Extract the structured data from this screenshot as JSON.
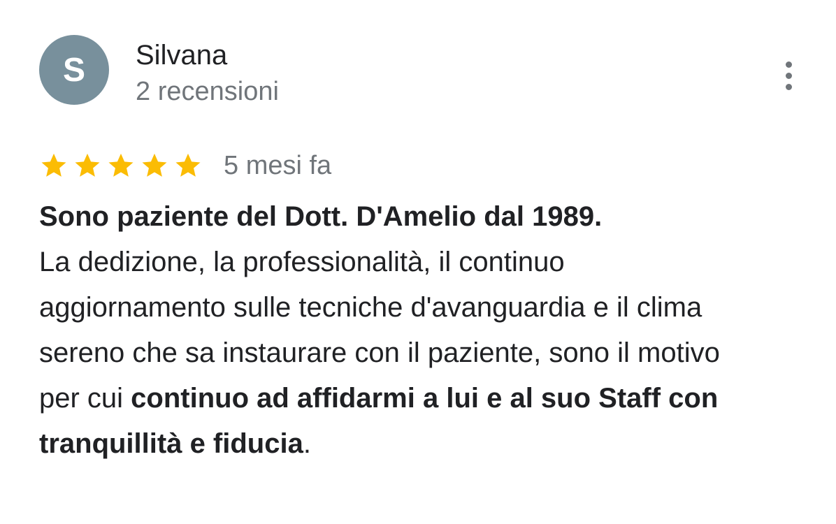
{
  "review": {
    "author": {
      "initial": "S",
      "name": "Silvana",
      "meta": "2 recensioni",
      "avatar_color": "#78909c"
    },
    "more_icon": "more-vert-icon",
    "rating": {
      "stars": 5,
      "max": 5,
      "star_color": "#fbbc04",
      "date": "5 mesi fa"
    },
    "text": {
      "headline": "Sono paziente del Dott. D'Amelio dal 1989.",
      "line1": "La dedizione, la professionalità, il continuo",
      "line2": "aggiornamento sulle tecniche d'avanguardia e il clima",
      "line3": "sereno che sa instaurare con il paziente, sono il motivo",
      "line4_plain": "per cui ",
      "line4_bold": "continuo ad affidarmi a lui e al suo Staff con",
      "line5_bold": "tranquillità e fiducia",
      "line5_plain": "."
    }
  }
}
